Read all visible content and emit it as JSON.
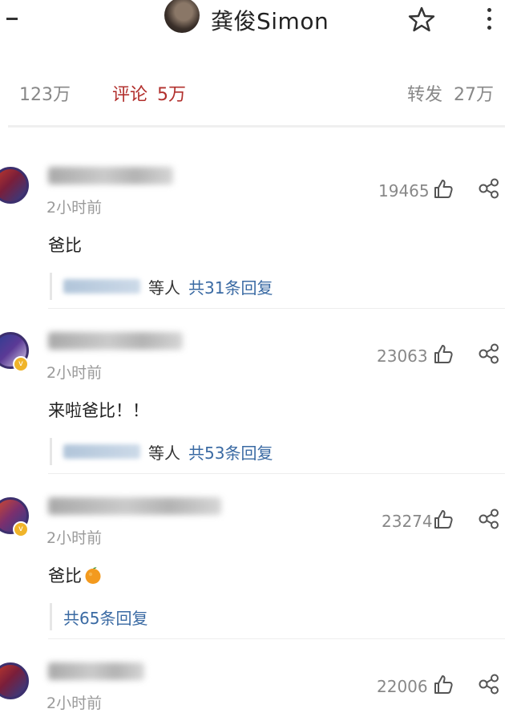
{
  "header": {
    "back_icon": "minus-icon",
    "owner_name": "龚俊Simon",
    "star_icon": "star-outline-icon",
    "more_icon": "vertical-dots-icon"
  },
  "tabs": {
    "likes": "123万",
    "comments_label": "评论",
    "comments_count": "5万",
    "reposts_label": "转发",
    "reposts_count": "27万"
  },
  "colors": {
    "accent": "#b2302d",
    "link": "#3a6aa3",
    "muted": "#888888"
  },
  "comments": [
    {
      "time": "2小时前",
      "likes": "19465",
      "text": "爸比",
      "reply_deng": "等人",
      "reply_count": "共31条回复"
    },
    {
      "time": "2小时前",
      "likes": "23063",
      "text": "来啦爸比！！",
      "reply_deng": "等人",
      "reply_count": "共53条回复"
    },
    {
      "time": "2小时前",
      "likes": "23274",
      "text": "爸比",
      "emoji_icon": "orange-emoji-icon",
      "reply_count": "共65条回复"
    },
    {
      "time": "2小时前",
      "likes": "22006"
    }
  ],
  "icons": {
    "like": "thumbs-up-icon",
    "share": "share-icon",
    "verified": "verified-badge-icon"
  }
}
